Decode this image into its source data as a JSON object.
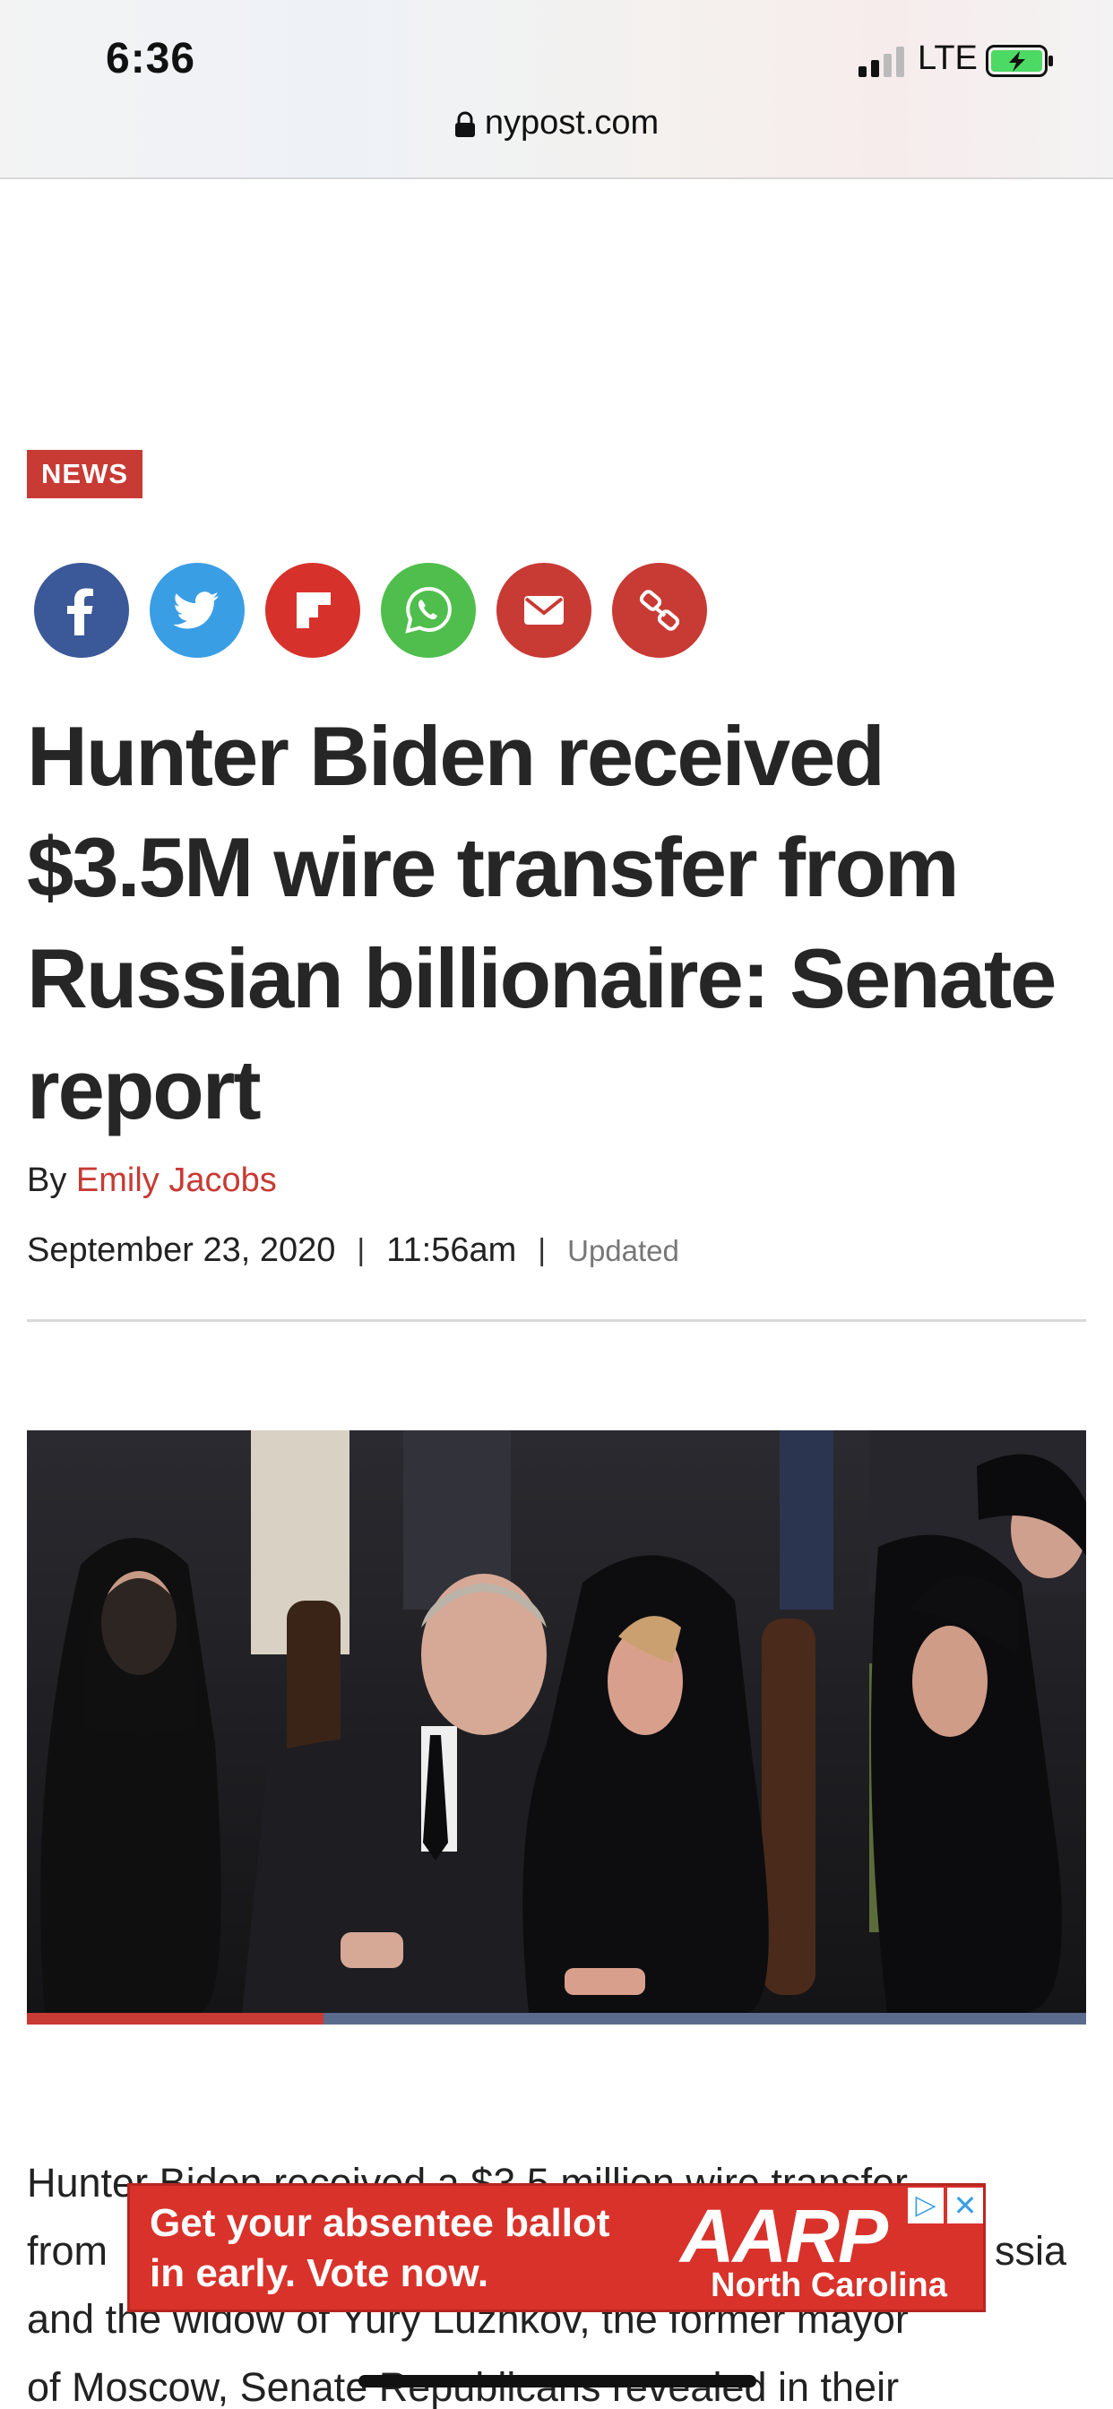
{
  "status_bar": {
    "time": "6:36",
    "carrier": "LTE",
    "icons": [
      "cellular-signal-icon",
      "battery-charging-icon"
    ]
  },
  "browser": {
    "url": "nypost.com",
    "icons": [
      "lock-icon"
    ]
  },
  "article": {
    "section_tag": "NEWS",
    "share_buttons": [
      {
        "name": "facebook",
        "icon": "facebook-icon",
        "color": "#3b5998"
      },
      {
        "name": "twitter",
        "icon": "twitter-icon",
        "color": "#3a9ee5"
      },
      {
        "name": "flipboard",
        "icon": "flipboard-icon",
        "color": "#d6322b"
      },
      {
        "name": "whatsapp",
        "icon": "whatsapp-icon",
        "color": "#4fbe4c"
      },
      {
        "name": "email",
        "icon": "email-icon",
        "color": "#c83a34"
      },
      {
        "name": "copy-link",
        "icon": "link-icon",
        "color": "#c83a34"
      }
    ],
    "headline": "Hunter Biden received $3.5M wire transfer from Russian billionaire: Senate report",
    "byline_prefix": "By ",
    "author": "Emily Jacobs",
    "date": "September 23, 2020",
    "separator": "|",
    "time": "11:56am",
    "updated_label": "Updated",
    "photo": {
      "slideshow_progress": 0.28
    },
    "body_lines": [
      "Hunter Biden received a $3.5 million wire transfer",
      "from",
      "and the widow of Yury Luzhkov, the former mayor",
      "of Moscow, Senate Republicans revealed in their"
    ],
    "body_fragment_right": "ssia"
  },
  "ad": {
    "text": "Get your absentee ballot in early. Vote now.",
    "brand": "AARP",
    "brand_sub": "North Carolina",
    "choices_icon": "ad-choices-icon",
    "close_icon": "close-icon",
    "colors": {
      "background": "#d8322b",
      "text": "#ffffff"
    }
  },
  "colors": {
    "accent": "#c83a34",
    "headline": "#262626"
  }
}
